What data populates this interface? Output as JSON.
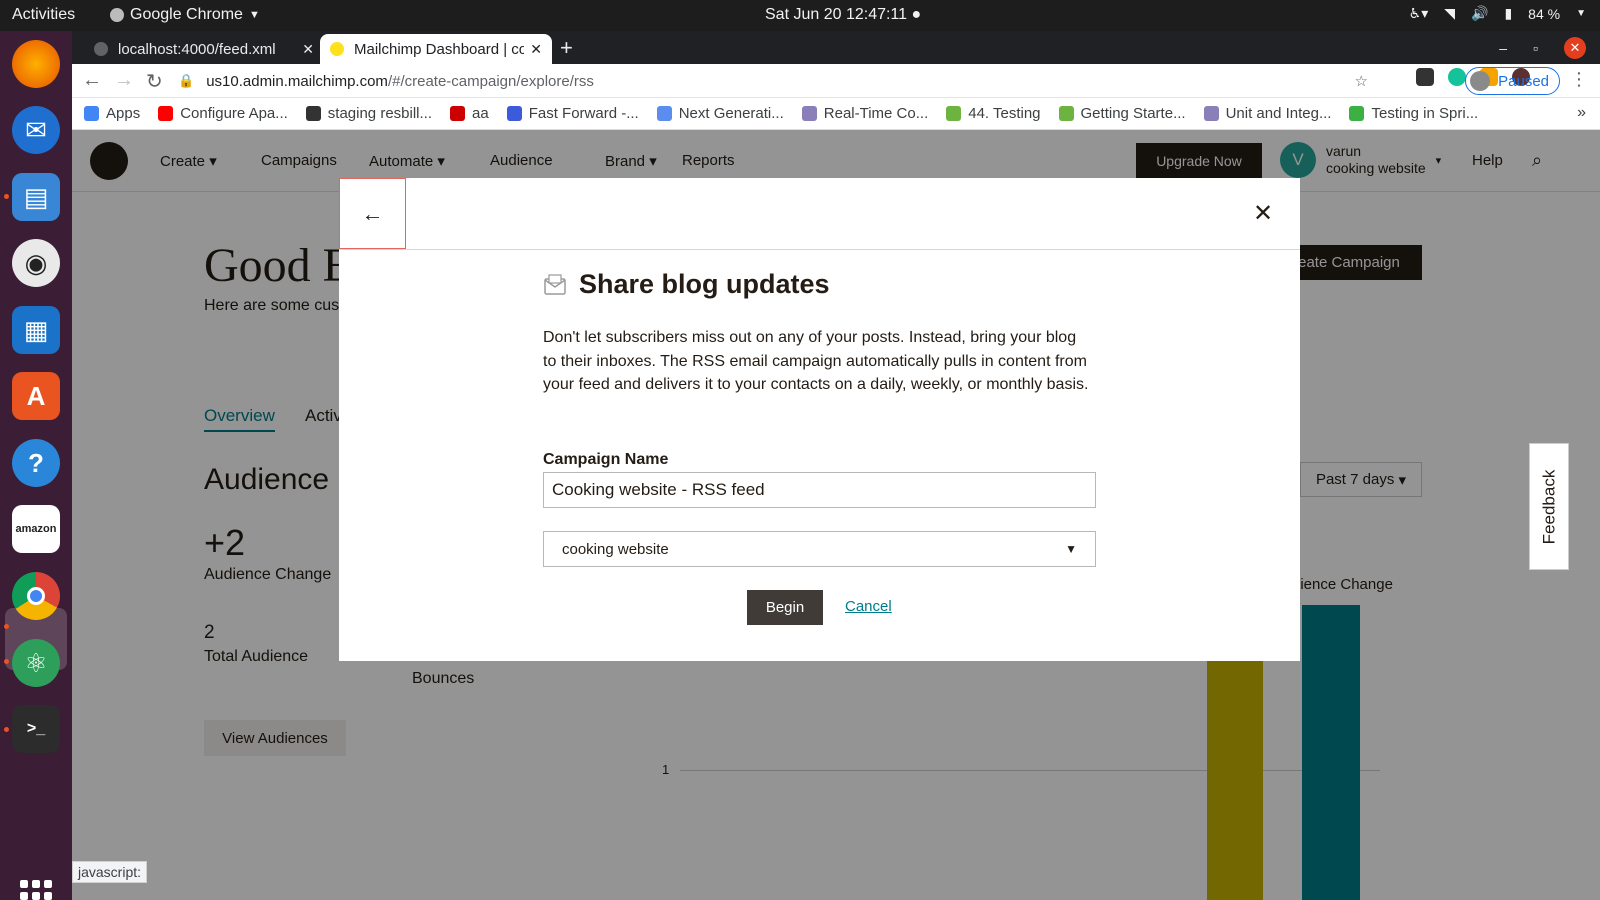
{
  "system": {
    "activities": "Activities",
    "app_name": "Google Chrome",
    "clock": "Sat Jun 20  12:47:11",
    "battery": "84 %"
  },
  "browser": {
    "tabs": [
      {
        "title": "localhost:4000/feed.xml"
      },
      {
        "title": "Mailchimp Dashboard | co"
      }
    ],
    "url_host": "us10.admin.mailchimp.com",
    "url_path": "/#/create-campaign/explore/rss",
    "profile_label": "Paused",
    "bookmarks": [
      {
        "label": "Apps",
        "color": "#4285f4"
      },
      {
        "label": "Configure Apa...",
        "color": "#ff0000"
      },
      {
        "label": "staging resbill...",
        "color": "#333333"
      },
      {
        "label": "aa",
        "color": "#cc0000"
      },
      {
        "label": "Fast Forward -...",
        "color": "#3b5bdb"
      },
      {
        "label": "Next Generati...",
        "color": "#5b8def"
      },
      {
        "label": "Real-Time Co...",
        "color": "#8a7fb8"
      },
      {
        "label": "44. Testing",
        "color": "#6db33f"
      },
      {
        "label": "Getting Starte...",
        "color": "#6db33f"
      },
      {
        "label": "Unit and Integ...",
        "color": "#8a7fb8"
      },
      {
        "label": "Testing in Spri...",
        "color": "#3cb043"
      }
    ],
    "status_text": "javascript:"
  },
  "app_nav": {
    "items": [
      "Create",
      "Campaigns",
      "Automate",
      "Audience",
      "Brand",
      "Reports"
    ],
    "upgrade": "Upgrade Now",
    "user_initial": "V",
    "user_name": "varun",
    "user_account": "cooking website",
    "help": "Help"
  },
  "dashboard": {
    "greeting": "Good E",
    "subtitle": "Here are some cus done tonight.",
    "tab_overview": "Overview",
    "tab_activity": "Activ",
    "audience_heading": "Audience",
    "audience_change_value": "+2",
    "audience_change_label": "Audience Change",
    "total_value": "2",
    "total_label": "Total Audience",
    "bounces_label": "Bounces",
    "view_audiences": "View Audiences",
    "create_campaign": "eate Campaign",
    "range": "Past 7 days",
    "chart_legend": "dience Change",
    "axis_tick": "1",
    "feedback": "Feedback"
  },
  "modal": {
    "title": "Share blog updates",
    "description": "Don't let subscribers miss out on any of your posts. Instead, bring your blog to their inboxes. The RSS email campaign automatically pulls in content from your feed and delivers it to your contacts on a daily, weekly, or monthly basis.",
    "name_label": "Campaign Name",
    "name_value": "Cooking website - RSS feed",
    "audience_selected": "cooking website",
    "begin": "Begin",
    "cancel": "Cancel"
  }
}
